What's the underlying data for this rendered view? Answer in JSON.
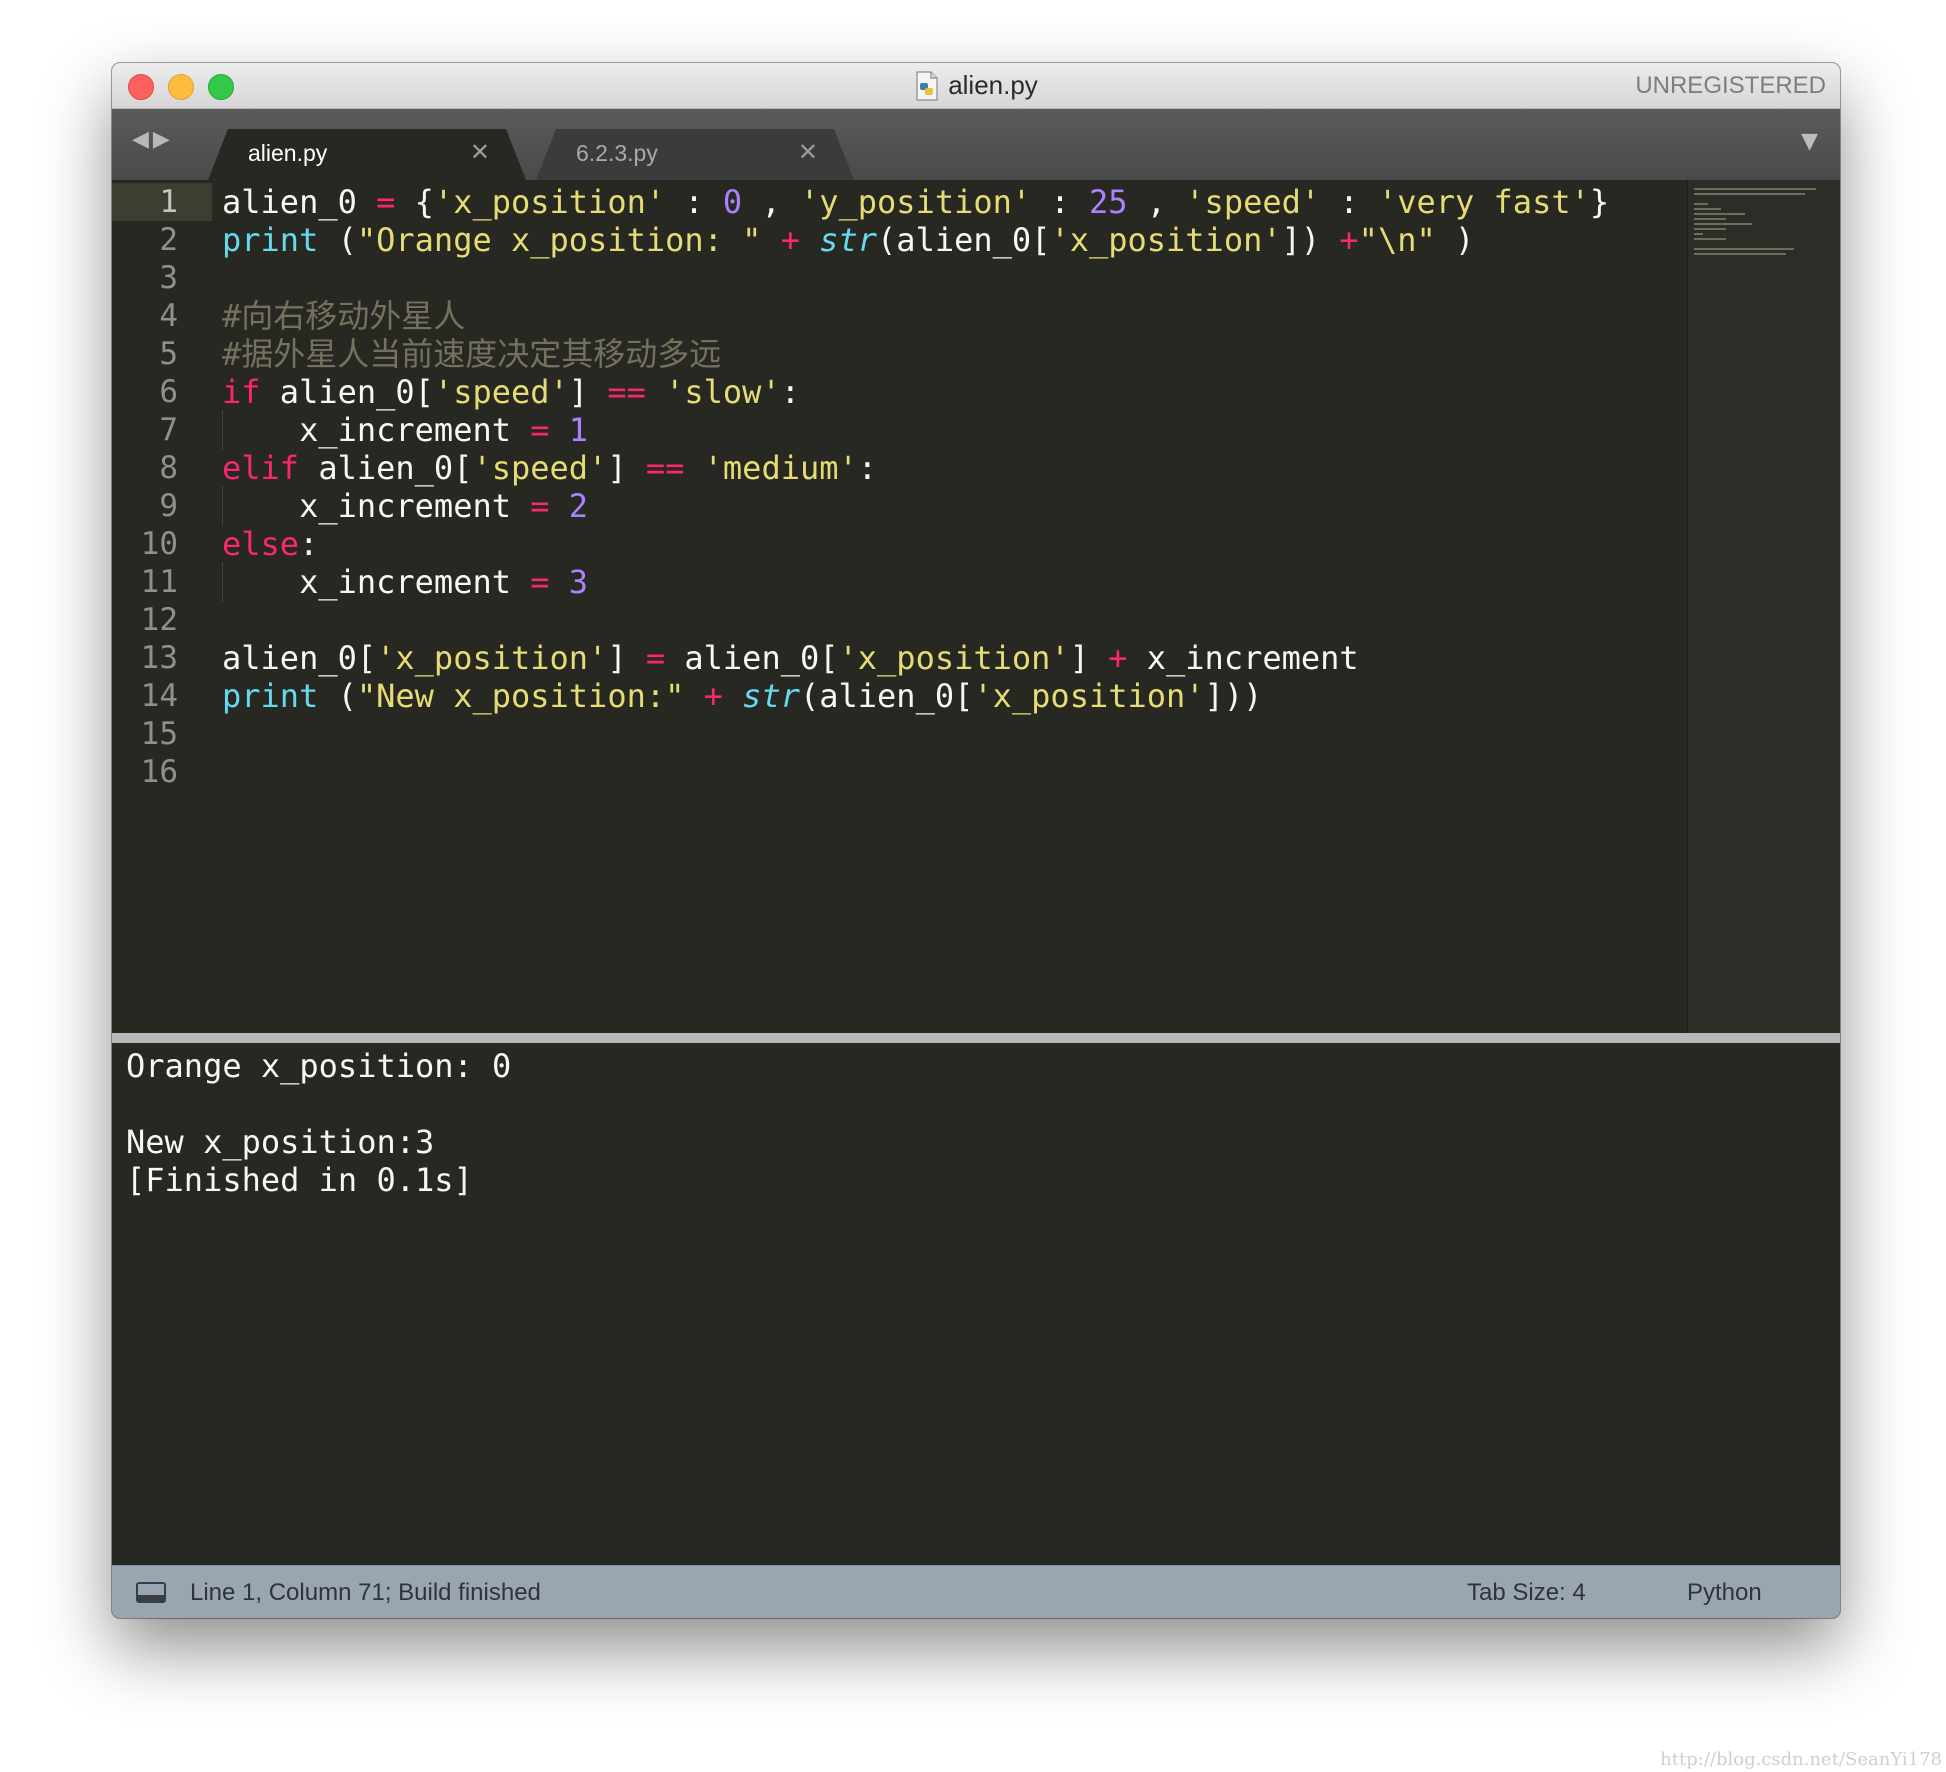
{
  "window": {
    "title": "alien.py",
    "unregistered_label": "UNREGISTERED"
  },
  "tabs": [
    {
      "label": "alien.py",
      "active": true
    },
    {
      "label": "6.2.3.py",
      "active": false
    }
  ],
  "icons": {
    "nav": "left-right-arrows-icon",
    "tab_close": "close-icon",
    "dropdown": "chevron-down-icon",
    "file": "python-file-icon",
    "panel": "panel-toggle-icon"
  },
  "editor": {
    "line_numbers": [
      "1",
      "2",
      "3",
      "4",
      "5",
      "6",
      "7",
      "8",
      "9",
      "10",
      "11",
      "12",
      "13",
      "14",
      "15",
      "16"
    ],
    "current_line": 1,
    "lines": [
      [
        [
          "plain",
          "alien_0 "
        ],
        [
          "op",
          "="
        ],
        [
          "plain",
          " {"
        ],
        [
          "str",
          "'x_position'"
        ],
        [
          "plain",
          " : "
        ],
        [
          "num",
          "0"
        ],
        [
          "plain",
          " , "
        ],
        [
          "str",
          "'y_position'"
        ],
        [
          "plain",
          " : "
        ],
        [
          "num",
          "25"
        ],
        [
          "plain",
          " , "
        ],
        [
          "str",
          "'speed'"
        ],
        [
          "plain",
          " : "
        ],
        [
          "str",
          "'very fast'"
        ],
        [
          "plain",
          "}"
        ]
      ],
      [
        [
          "fn",
          "print"
        ],
        [
          "plain",
          " ("
        ],
        [
          "str",
          "\"Orange x_position: \""
        ],
        [
          "plain",
          " "
        ],
        [
          "op",
          "+"
        ],
        [
          "plain",
          " "
        ],
        [
          "fn-it",
          "str"
        ],
        [
          "plain",
          "(alien_0["
        ],
        [
          "str",
          "'x_position'"
        ],
        [
          "plain",
          "]) "
        ],
        [
          "op",
          "+"
        ],
        [
          "str",
          "\"\\n\""
        ],
        [
          "plain",
          " )"
        ]
      ],
      [],
      [
        [
          "cm",
          "#向右移动外星人"
        ]
      ],
      [
        [
          "cm",
          "#据外星人当前速度决定其移动多远"
        ]
      ],
      [
        [
          "kw",
          "if"
        ],
        [
          "plain",
          " alien_0["
        ],
        [
          "str",
          "'speed'"
        ],
        [
          "plain",
          "] "
        ],
        [
          "op",
          "=="
        ],
        [
          "plain",
          " "
        ],
        [
          "str",
          "'slow'"
        ],
        [
          "plain",
          ":"
        ]
      ],
      [
        [
          "plain",
          "    x_increment "
        ],
        [
          "op",
          "="
        ],
        [
          "plain",
          " "
        ],
        [
          "num",
          "1"
        ]
      ],
      [
        [
          "kw",
          "elif"
        ],
        [
          "plain",
          " alien_0["
        ],
        [
          "str",
          "'speed'"
        ],
        [
          "plain",
          "] "
        ],
        [
          "op",
          "=="
        ],
        [
          "plain",
          " "
        ],
        [
          "str",
          "'medium'"
        ],
        [
          "plain",
          ":"
        ]
      ],
      [
        [
          "plain",
          "    x_increment "
        ],
        [
          "op",
          "="
        ],
        [
          "plain",
          " "
        ],
        [
          "num",
          "2"
        ]
      ],
      [
        [
          "kw",
          "else"
        ],
        [
          "plain",
          ":"
        ]
      ],
      [
        [
          "plain",
          "    x_increment "
        ],
        [
          "op",
          "="
        ],
        [
          "plain",
          " "
        ],
        [
          "num",
          "3"
        ]
      ],
      [],
      [
        [
          "plain",
          "alien_0["
        ],
        [
          "str",
          "'x_position'"
        ],
        [
          "plain",
          "] "
        ],
        [
          "op",
          "="
        ],
        [
          "plain",
          " alien_0["
        ],
        [
          "str",
          "'x_position'"
        ],
        [
          "plain",
          "] "
        ],
        [
          "op",
          "+"
        ],
        [
          "plain",
          " x_increment"
        ]
      ],
      [
        [
          "fn",
          "print"
        ],
        [
          "plain",
          " ("
        ],
        [
          "str",
          "\"New x_position:\""
        ],
        [
          "plain",
          " "
        ],
        [
          "op",
          "+"
        ],
        [
          "plain",
          " "
        ],
        [
          "fn-it",
          "str"
        ],
        [
          "plain",
          "(alien_0["
        ],
        [
          "str",
          "'x_position'"
        ],
        [
          "plain",
          "]))"
        ]
      ],
      [],
      []
    ]
  },
  "output": {
    "lines": [
      "Orange x_position: 0",
      "",
      "New x_position:3",
      "[Finished in 0.1s]"
    ]
  },
  "statusbar": {
    "position_text": "Line 1, Column 71; Build finished",
    "tab_size": "Tab Size: 4",
    "syntax": "Python"
  },
  "watermark": "http://blog.csdn.net/SeanYi178"
}
